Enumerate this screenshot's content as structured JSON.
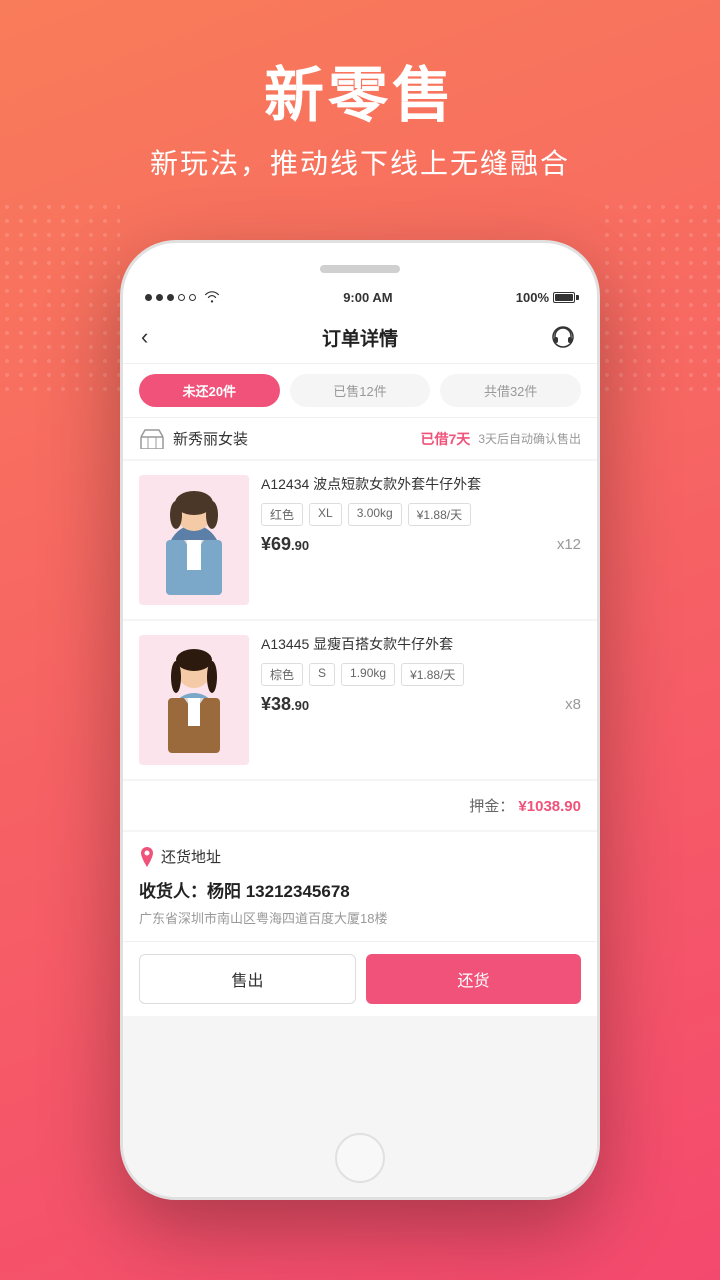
{
  "background": {
    "gradient_start": "#f97c5a",
    "gradient_end": "#f4496e"
  },
  "header": {
    "title": "新零售",
    "subtitle": "新玩法，推动线下线上无缝融合"
  },
  "status_bar": {
    "time": "9:00 AM",
    "battery": "100%"
  },
  "nav": {
    "title": "订单详情",
    "back_icon": "‹"
  },
  "tabs": [
    {
      "label": "未还20件",
      "active": true
    },
    {
      "label": "已售12件",
      "active": false
    },
    {
      "label": "共借32件",
      "active": false
    }
  ],
  "brand": {
    "name": "新秀丽女装",
    "borrowed_days": "已借7天",
    "auto_confirm": "3天后自动确认售出"
  },
  "products": [
    {
      "id": "A12434",
      "name": "A12434 波点短款女款外套牛仔外套",
      "tags": [
        "红色",
        "XL",
        "3.00kg",
        "¥1.88/天"
      ],
      "price_main": "¥69",
      "price_decimal": ".90",
      "quantity": "x12",
      "img_emoji": "👗"
    },
    {
      "id": "A13445",
      "name": "A13445 显瘦百搭女款牛仔外套",
      "tags": [
        "棕色",
        "S",
        "1.90kg",
        "¥1.88/天"
      ],
      "price_main": "¥38",
      "price_decimal": ".90",
      "quantity": "x8",
      "img_emoji": "👘"
    }
  ],
  "deposit": {
    "label": "押金：",
    "amount": "¥1038.90"
  },
  "address": {
    "title": "还货地址",
    "contact": "收货人：杨阳  13212345678",
    "detail": "广东省深圳市南山区粤海四道百度大厦18楼"
  },
  "buttons": {
    "sell": "售出",
    "return": "还货"
  }
}
